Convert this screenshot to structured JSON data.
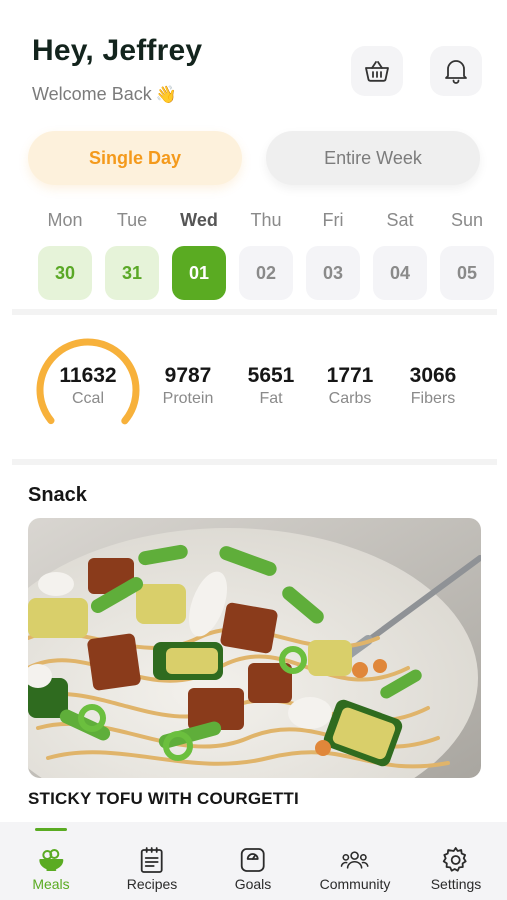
{
  "header": {
    "greeting": "Hey, Jeffrey",
    "welcome": "Welcome Back",
    "wave_icon": "waving-hand-icon"
  },
  "actions": {
    "basket_icon": "basket-icon",
    "bell_icon": "bell-icon"
  },
  "segments": {
    "single_day": "Single Day",
    "entire_week": "Entire Week",
    "selected": "single_day"
  },
  "week": [
    {
      "name": "Mon",
      "num": "30",
      "state": "done"
    },
    {
      "name": "Tue",
      "num": "31",
      "state": "done"
    },
    {
      "name": "Wed",
      "num": "01",
      "state": "current"
    },
    {
      "name": "Thu",
      "num": "02",
      "state": "upcoming"
    },
    {
      "name": "Fri",
      "num": "03",
      "state": "upcoming"
    },
    {
      "name": "Sat",
      "num": "04",
      "state": "upcoming"
    },
    {
      "name": "Sun",
      "num": "05",
      "state": "upcoming"
    }
  ],
  "nutrition": {
    "calories": {
      "value": "11632",
      "label": "Ccal",
      "progress": 0.72
    },
    "protein": {
      "value": "9787",
      "label": "Protein"
    },
    "fat": {
      "value": "5651",
      "label": "Fat"
    },
    "carbs": {
      "value": "1771",
      "label": "Carbs"
    },
    "fibers": {
      "value": "3066",
      "label": "Fibers"
    }
  },
  "meal": {
    "section": "Snack",
    "dish": "STICKY TOFU WITH COURGETTI"
  },
  "tabs": [
    {
      "label": "Meals",
      "icon": "meals-bowl-icon",
      "active": true
    },
    {
      "label": "Recipes",
      "icon": "recipes-list-icon",
      "active": false
    },
    {
      "label": "Goals",
      "icon": "goals-scale-icon",
      "active": false
    },
    {
      "label": "Community",
      "icon": "community-people-icon",
      "active": false
    },
    {
      "label": "Settings",
      "icon": "settings-gear-icon",
      "active": false
    }
  ],
  "colors": {
    "accent_green": "#5aab22",
    "accent_orange": "#f49a1c",
    "ring_orange": "#f7b13b"
  }
}
